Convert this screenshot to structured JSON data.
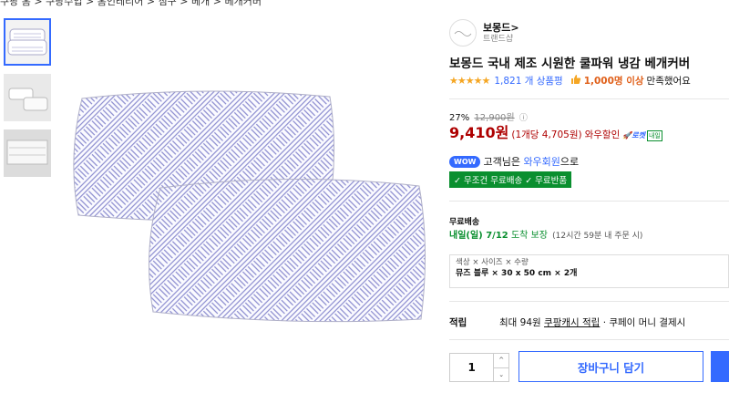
{
  "breadcrumb": "쿠팡 홈 > 쿠팡수입 > 홈인테리어 > 침구 > 베개 > 베개커버",
  "brand": {
    "name": "보몽드>",
    "sub": "트랜드샵"
  },
  "product": {
    "title": "보몽드 국내 제조 시원한 쿨파워 냉감 베개커버",
    "stars": "★★★★★",
    "review_count": "1,821 개 상품평",
    "satisfied_count": "1,000명 이상",
    "satisfied_text": "만족했어요"
  },
  "price": {
    "discount": "27%",
    "original": "12,900원",
    "info_icon": "ⓘ",
    "final": "9,410원",
    "unit": "(1개당 4,705원)",
    "wow_label": "와우할인",
    "rocket_label": "로켓",
    "rocket_tag": "내일"
  },
  "wow": {
    "badge": "WOW",
    "prefix": "고객님은",
    "member": "와우회원",
    "suffix": "으로"
  },
  "free_badge": "✓ 무조건 무료배송 ✓ 무료반품",
  "delivery": {
    "label": "무료배송",
    "date": "내일(일) 7/12",
    "guarantee": "도착 보장",
    "note": "(12시간 59분 내 주문 시)"
  },
  "option": {
    "label": "색상 × 사이즈 × 수량",
    "value": "뮤즈 블루 × 30 x 50 cm × 2개"
  },
  "points": {
    "label": "적립",
    "prefix": "최대 94원",
    "link": "쿠팡캐시 적립",
    "suffix": "· 쿠페이 머니 결제시"
  },
  "quantity": {
    "value": "1",
    "up": "^",
    "down": "⌄"
  },
  "cart_button": "장바구니 담기",
  "icons": {
    "star": "star-icon",
    "thumb": "thumbs-up-icon",
    "info": "info-icon"
  },
  "colors": {
    "accent": "#346aff",
    "price": "#ae0000",
    "green": "#0a8f2f",
    "star": "#f5a623"
  }
}
